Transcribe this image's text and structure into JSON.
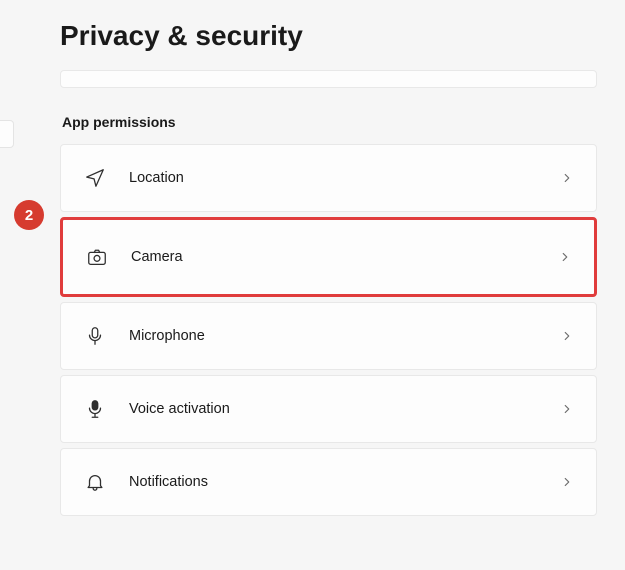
{
  "page": {
    "title": "Privacy & security",
    "section_heading": "App permissions"
  },
  "permissions": {
    "location": {
      "label": "Location"
    },
    "camera": {
      "label": "Camera"
    },
    "microphone": {
      "label": "Microphone"
    },
    "voice_activation": {
      "label": "Voice activation"
    },
    "notifications": {
      "label": "Notifications"
    }
  },
  "annotation": {
    "step_number": "2"
  }
}
